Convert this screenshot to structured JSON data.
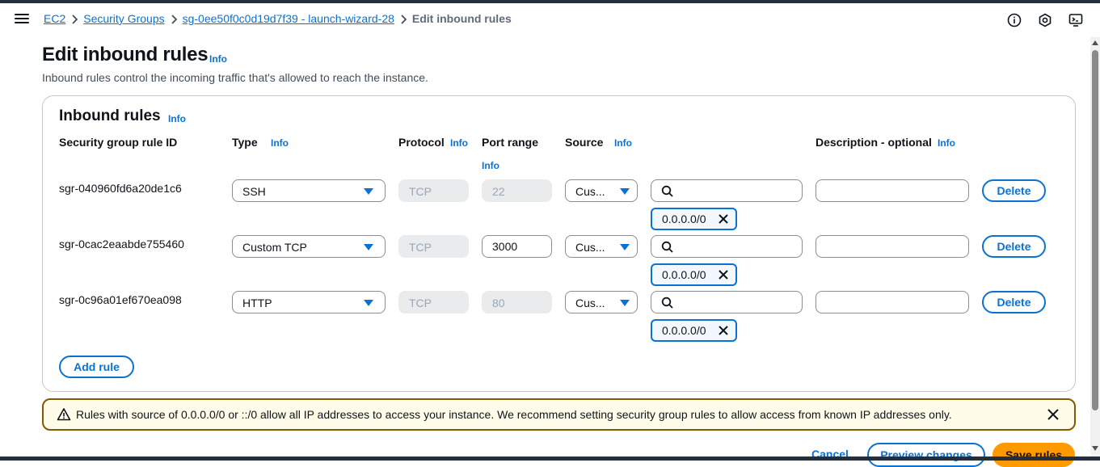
{
  "breadcrumb": {
    "items": [
      "EC2",
      "Security Groups",
      "sg-0ee50f0c0d19d7f39 - launch-wizard-28"
    ],
    "current": "Edit inbound rules"
  },
  "header": {
    "title": "Edit inbound rules",
    "info": "Info",
    "description": "Inbound rules control the incoming traffic that's allowed to reach the instance."
  },
  "container": {
    "title": "Inbound rules",
    "info": "Info",
    "columns": {
      "rule_id": "Security group rule ID",
      "type": "Type",
      "protocol": "Protocol",
      "port_range": "Port range",
      "source": "Source",
      "description": "Description - optional",
      "info": "Info"
    },
    "rules": [
      {
        "id": "sgr-040960fd6a20de1c6",
        "type": "SSH",
        "protocol": "TCP",
        "port": "22",
        "port_editable": false,
        "source": "Cus...",
        "search_value": "",
        "token": "0.0.0.0/0",
        "description": "",
        "delete": "Delete"
      },
      {
        "id": "sgr-0cac2eaabde755460",
        "type": "Custom TCP",
        "protocol": "TCP",
        "port": "3000",
        "port_editable": true,
        "source": "Cus...",
        "search_value": "",
        "token": "0.0.0.0/0",
        "description": "",
        "delete": "Delete"
      },
      {
        "id": "sgr-0c96a01ef670ea098",
        "type": "HTTP",
        "protocol": "TCP",
        "port": "80",
        "port_editable": false,
        "source": "Cus...",
        "search_value": "",
        "token": "0.0.0.0/0",
        "description": "",
        "delete": "Delete"
      }
    ],
    "add_rule": "Add rule"
  },
  "warning": {
    "text": "Rules with source of 0.0.0.0/0 or ::/0 allow all IP addresses to access your instance. We recommend setting security group rules to allow access from known IP addresses only."
  },
  "footer": {
    "cancel": "Cancel",
    "preview": "Preview changes",
    "save": "Save rules"
  },
  "colors": {
    "link": "#0972d3",
    "primary_button": "#ff9900",
    "warning_border": "#855900",
    "warning_bg": "#fffce9",
    "top_bar": "#232f3e"
  },
  "icons": [
    "menu-icon",
    "chevron-right-icon",
    "info-circle-icon",
    "settings-hex-icon",
    "cloudshell-icon",
    "search-icon",
    "close-icon",
    "warning-icon",
    "caret-down-icon"
  ]
}
